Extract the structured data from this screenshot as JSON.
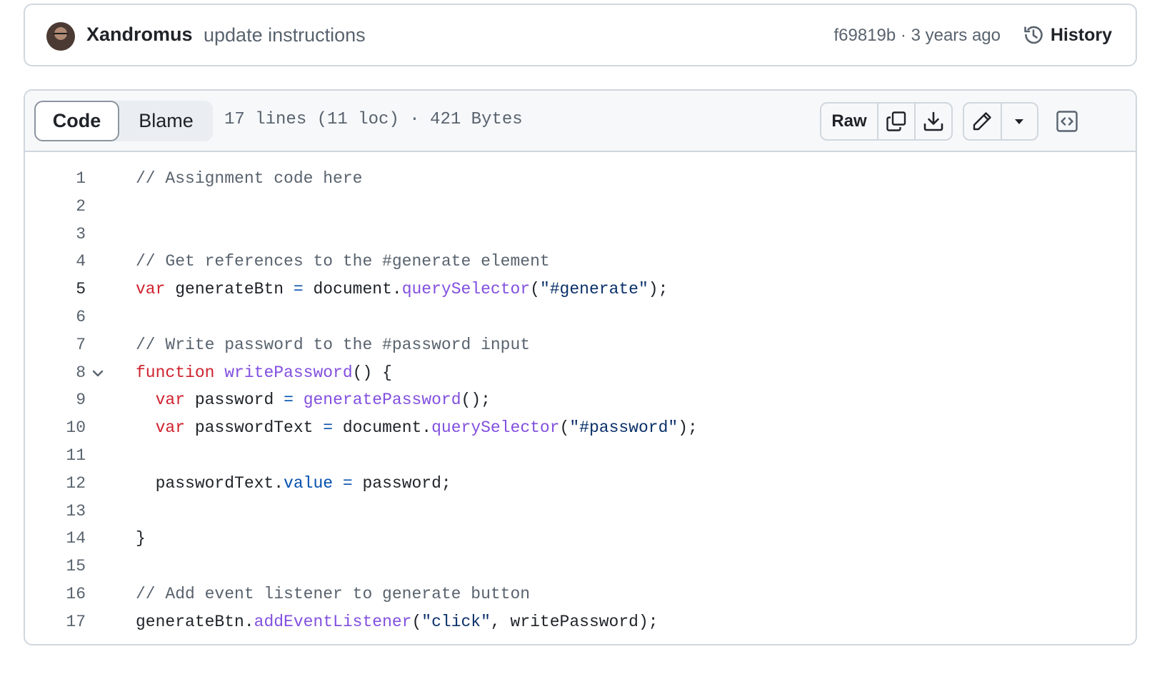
{
  "commit": {
    "author": "Xandromus",
    "message": "update instructions",
    "sha": "f69819b",
    "separator": " · ",
    "age": "3 years ago",
    "history_label": "History"
  },
  "file": {
    "tabs": {
      "code": "Code",
      "blame": "Blame"
    },
    "info": "17 lines (11 loc) · 421 Bytes",
    "raw_label": "Raw"
  },
  "icons": {
    "history": "history-icon",
    "copy": "copy-icon",
    "download": "download-icon",
    "edit": "pencil-icon",
    "more": "triangle-down-icon",
    "symbols": "code-square-icon",
    "fold": "chevron-down-icon"
  },
  "colors": {
    "comment": "#59636e",
    "keyword": "#cf222e",
    "function": "#8250df",
    "string": "#0a3069",
    "property": "#0550ae",
    "border": "#d0d7de"
  },
  "code_lines": [
    {
      "n": "1",
      "tokens": [
        [
          "c",
          "// Assignment code here"
        ]
      ]
    },
    {
      "n": "2",
      "tokens": []
    },
    {
      "n": "3",
      "tokens": []
    },
    {
      "n": "4",
      "tokens": [
        [
          "c",
          "// Get references to the #generate element"
        ]
      ]
    },
    {
      "n": "5",
      "active": true,
      "tokens": [
        [
          "k",
          "var"
        ],
        [
          "",
          " generateBtn "
        ],
        [
          "o",
          "="
        ],
        [
          "",
          " document."
        ],
        [
          "f",
          "querySelector"
        ],
        [
          "",
          "("
        ],
        [
          "s",
          "\"#generate\""
        ],
        [
          "",
          ");"
        ]
      ]
    },
    {
      "n": "6",
      "tokens": []
    },
    {
      "n": "7",
      "tokens": [
        [
          "c",
          "// Write password to the #password input"
        ]
      ]
    },
    {
      "n": "8",
      "fold": true,
      "tokens": [
        [
          "k",
          "function"
        ],
        [
          "",
          " "
        ],
        [
          "f",
          "writePassword"
        ],
        [
          "",
          "() {"
        ]
      ]
    },
    {
      "n": "9",
      "tokens": [
        [
          "",
          "  "
        ],
        [
          "k",
          "var"
        ],
        [
          "",
          " password "
        ],
        [
          "o",
          "="
        ],
        [
          "",
          " "
        ],
        [
          "f",
          "generatePassword"
        ],
        [
          "",
          "();"
        ]
      ]
    },
    {
      "n": "10",
      "tokens": [
        [
          "",
          "  "
        ],
        [
          "k",
          "var"
        ],
        [
          "",
          " passwordText "
        ],
        [
          "o",
          "="
        ],
        [
          "",
          " document."
        ],
        [
          "f",
          "querySelector"
        ],
        [
          "",
          "("
        ],
        [
          "s",
          "\"#password\""
        ],
        [
          "",
          ");"
        ]
      ]
    },
    {
      "n": "11",
      "tokens": []
    },
    {
      "n": "12",
      "tokens": [
        [
          "",
          "  passwordText."
        ],
        [
          "o",
          "value"
        ],
        [
          "",
          " "
        ],
        [
          "o",
          "="
        ],
        [
          "",
          " password;"
        ]
      ]
    },
    {
      "n": "13",
      "tokens": []
    },
    {
      "n": "14",
      "tokens": [
        [
          "",
          "}"
        ]
      ]
    },
    {
      "n": "15",
      "tokens": []
    },
    {
      "n": "16",
      "tokens": [
        [
          "c",
          "// Add event listener to generate button"
        ]
      ]
    },
    {
      "n": "17",
      "tokens": [
        [
          "",
          "generateBtn."
        ],
        [
          "f",
          "addEventListener"
        ],
        [
          "",
          "("
        ],
        [
          "s",
          "\"click\""
        ],
        [
          "",
          ", writePassword);"
        ]
      ]
    }
  ]
}
